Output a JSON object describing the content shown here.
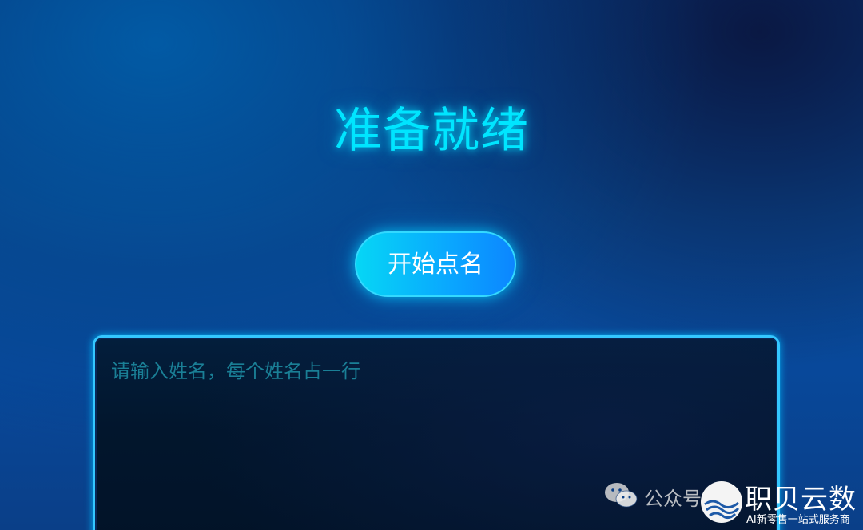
{
  "status": {
    "title": "准备就绪"
  },
  "actions": {
    "start_label": "开始点名"
  },
  "names_input": {
    "placeholder": "请输入姓名，每个姓名占一行",
    "value": ""
  },
  "watermark": {
    "label": "公众号",
    "icon": "wechat-icon",
    "brand_name": "职贝云数",
    "tagline": "AI新零售一站式服务商"
  },
  "colors": {
    "accent": "#00e5ff",
    "button": "#0aa6ff",
    "border": "#34c7ff",
    "background": "#0a4a93"
  }
}
